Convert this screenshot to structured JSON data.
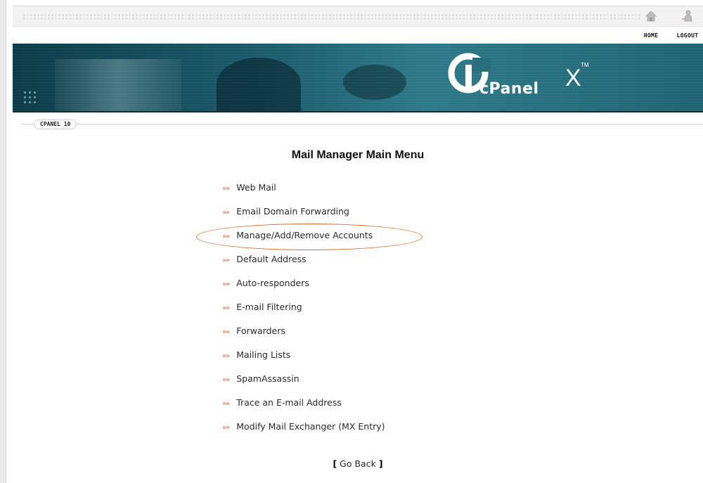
{
  "header": {
    "home_label": "HOME",
    "logout_label": "LOGOUT"
  },
  "banner": {
    "logo_word": "cPanel",
    "logo_x": "X",
    "logo_tm": "TM"
  },
  "breadcrumb": "CPANEL 10",
  "page_title": "Mail Manager Main Menu",
  "menu_arrow": "»»",
  "menu_items": [
    "Web Mail",
    "Email Domain Forwarding",
    "Manage/Add/Remove Accounts",
    "Default Address",
    "Auto-responders",
    "E-mail Filtering",
    "Forwarders",
    "Mailing Lists",
    "SpamAssassin",
    "Trace an E-mail Address",
    "Modify Mail Exchanger (MX Entry)"
  ],
  "go_back": {
    "open_bracket": "[",
    "label": "Go Back",
    "close_bracket": "]"
  },
  "colors": {
    "accent_arrow": "#e8692a",
    "banner": "#1a5968"
  }
}
